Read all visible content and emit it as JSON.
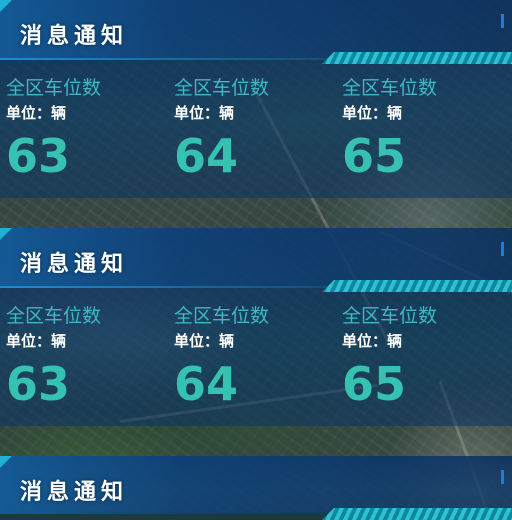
{
  "panels": [
    {
      "title": "消息通知",
      "stats": [
        {
          "label": "全区车位数",
          "unit": "单位：辆",
          "value": "63"
        },
        {
          "label": "全区车位数",
          "unit": "单位：辆",
          "value": "64"
        },
        {
          "label": "全区车位数",
          "unit": "单位：辆",
          "value": "65"
        }
      ]
    },
    {
      "title": "消息通知",
      "stats": [
        {
          "label": "全区车位数",
          "unit": "单位：辆",
          "value": "63"
        },
        {
          "label": "全区车位数",
          "unit": "单位：辆",
          "value": "64"
        },
        {
          "label": "全区车位数",
          "unit": "单位：辆",
          "value": "65"
        }
      ]
    },
    {
      "title": "消息通知",
      "stats": []
    }
  ],
  "colors": {
    "accent": "#1fb0d8",
    "stat_value": "#36c2b0",
    "stat_label": "#3fb8c4",
    "title": "#ffffff"
  }
}
